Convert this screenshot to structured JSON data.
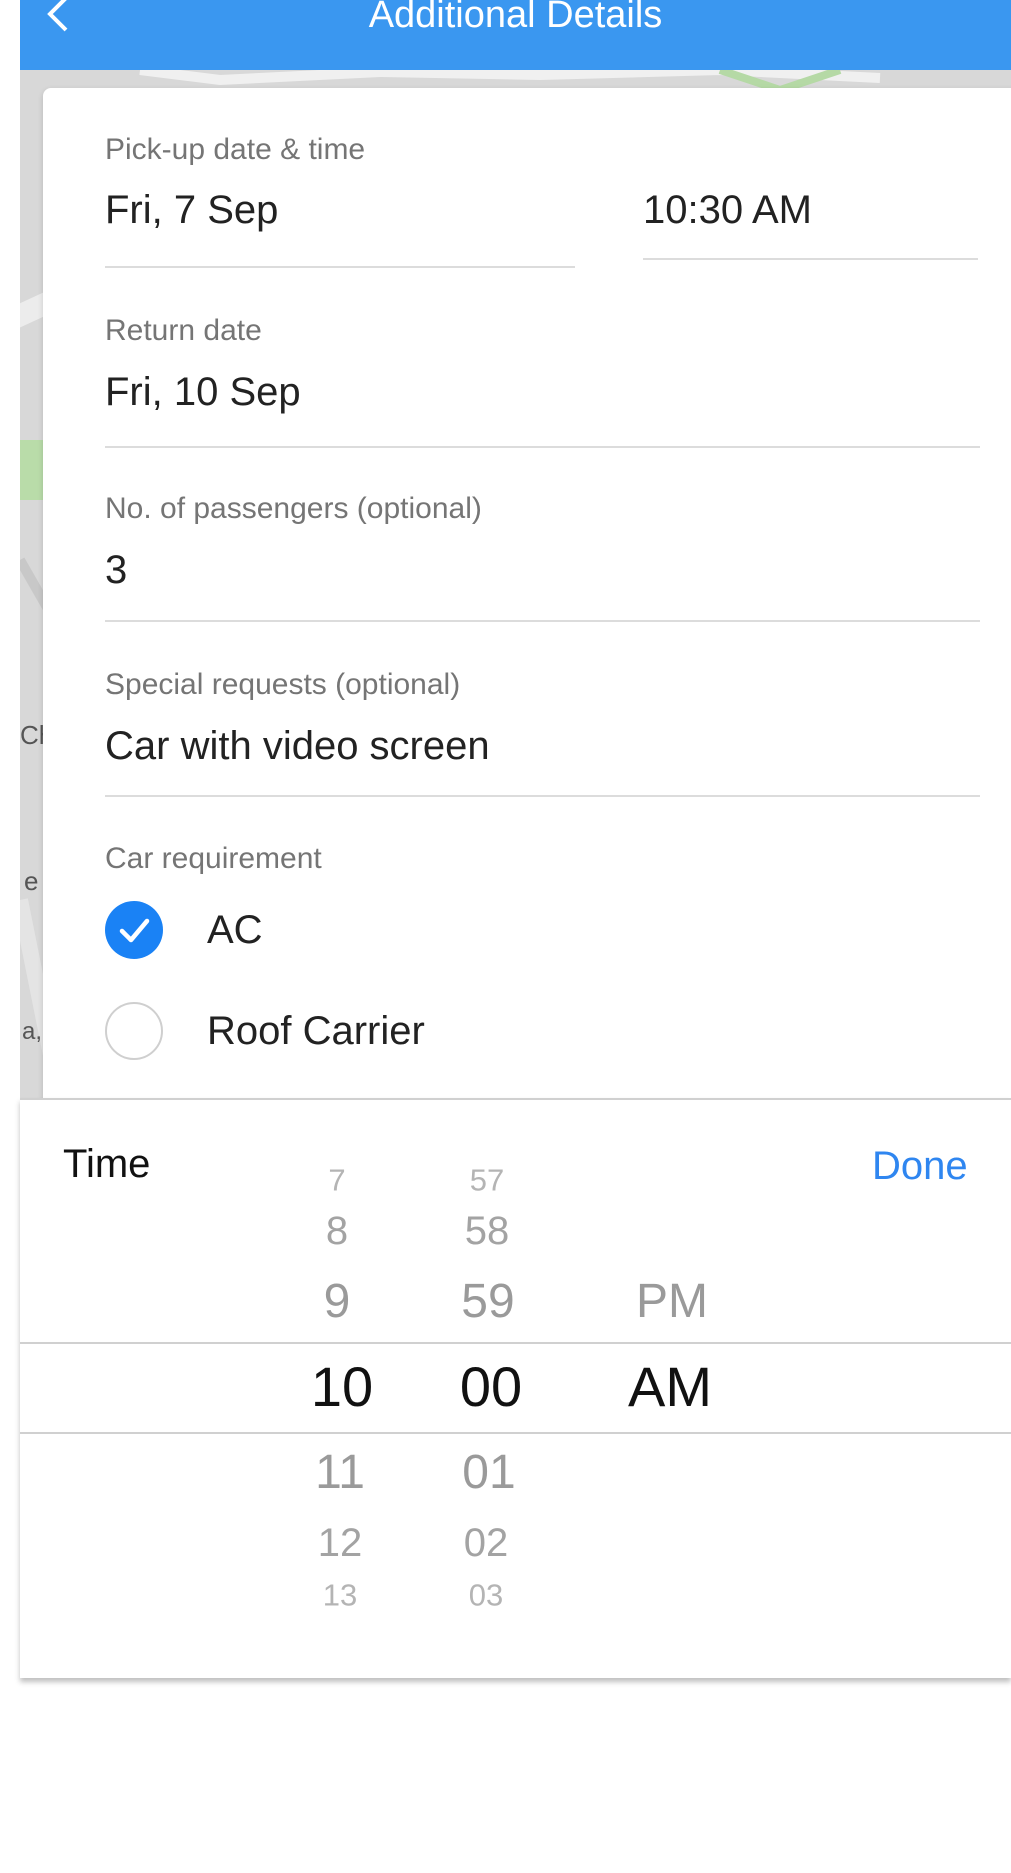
{
  "header": {
    "title": "Additional Details"
  },
  "form": {
    "pickup": {
      "label": "Pick-up date & time",
      "date": "Fri, 7 Sep",
      "time": "10:30 AM"
    },
    "return_date": {
      "label": "Return date",
      "value": "Fri, 10 Sep"
    },
    "passengers": {
      "label": "No. of passengers (optional)",
      "value": "3"
    },
    "special_requests": {
      "label": "Special requests (optional)",
      "value": "Car with video screen"
    },
    "car_requirement": {
      "label": "Car requirement",
      "options": [
        {
          "label": "AC",
          "checked": true
        },
        {
          "label": "Roof Carrier",
          "checked": false
        }
      ]
    }
  },
  "map_labels": [
    "Ch",
    "e",
    "a,"
  ],
  "picker": {
    "title": "Time",
    "done_label": "Done",
    "hours": [
      "7",
      "8",
      "9",
      "10",
      "11",
      "12",
      "13"
    ],
    "minutes": [
      "57",
      "58",
      "59",
      "00",
      "01",
      "02",
      "03"
    ],
    "periods": [
      "PM",
      "AM"
    ],
    "selected": {
      "hour": "10",
      "minute": "00",
      "period": "AM"
    }
  },
  "colors": {
    "appbar": "#3a97f0",
    "accent": "#1a82f5",
    "done": "#2f86f0"
  }
}
